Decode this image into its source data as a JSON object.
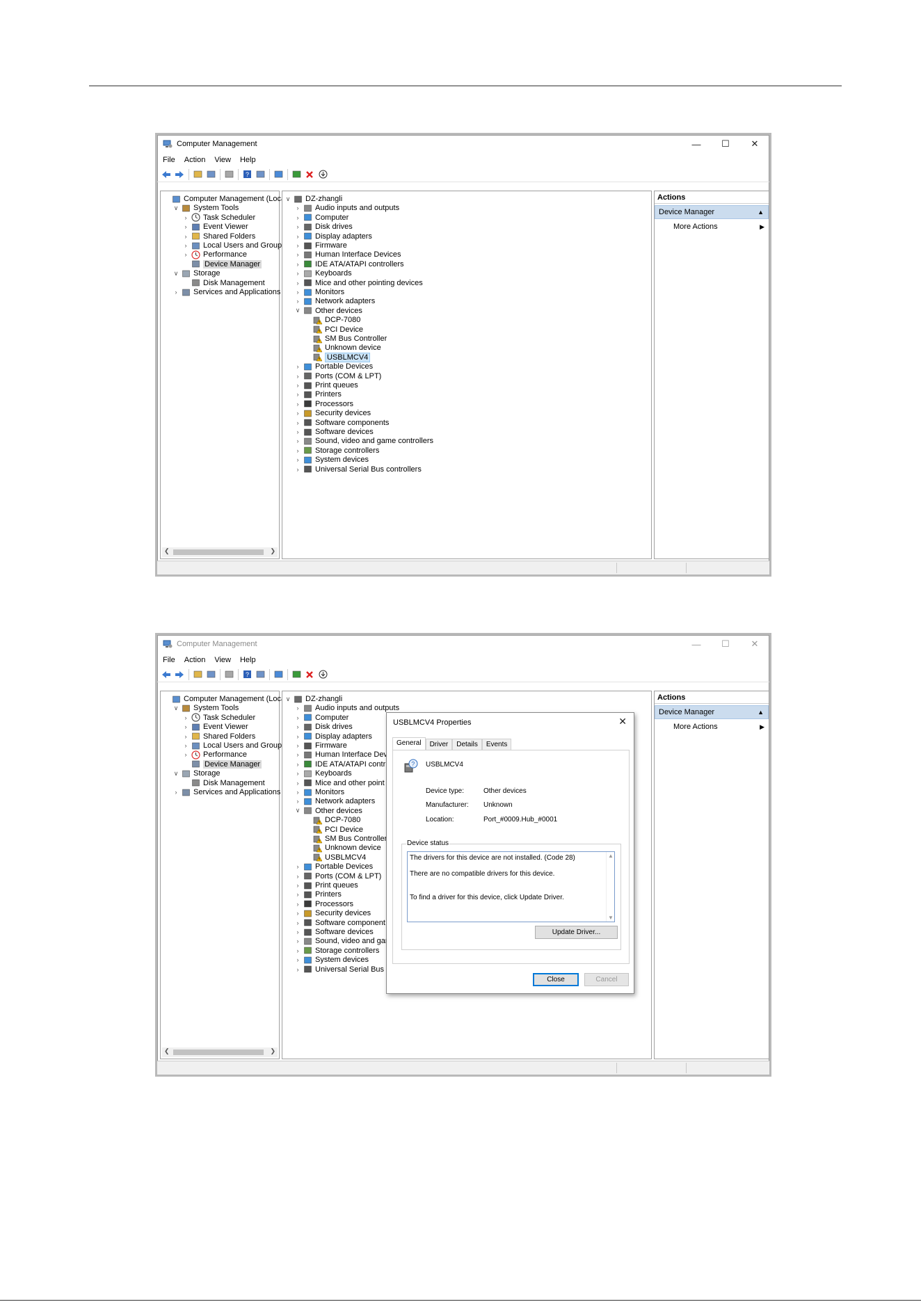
{
  "windows": [
    {
      "title": "Computer Management",
      "menu": [
        "File",
        "Action",
        "View",
        "Help"
      ],
      "left_tree": [
        {
          "label": "Computer Management (Local",
          "level": 0,
          "expander": "",
          "icon": "computer-management-icon",
          "selected": false
        },
        {
          "label": "System Tools",
          "level": 1,
          "expander": "down",
          "icon": "tools-icon",
          "selected": false
        },
        {
          "label": "Task Scheduler",
          "level": 2,
          "expander": "right",
          "icon": "clock-icon",
          "selected": false
        },
        {
          "label": "Event Viewer",
          "level": 2,
          "expander": "right",
          "icon": "event-viewer-icon",
          "selected": false
        },
        {
          "label": "Shared Folders",
          "level": 2,
          "expander": "right",
          "icon": "shared-folder-icon",
          "selected": false
        },
        {
          "label": "Local Users and Groups",
          "level": 2,
          "expander": "right",
          "icon": "users-icon",
          "selected": false
        },
        {
          "label": "Performance",
          "level": 2,
          "expander": "right",
          "icon": "performance-icon",
          "selected": false
        },
        {
          "label": "Device Manager",
          "level": 2,
          "expander": "",
          "icon": "device-manager-icon",
          "selected": true
        },
        {
          "label": "Storage",
          "level": 1,
          "expander": "down",
          "icon": "storage-icon",
          "selected": false
        },
        {
          "label": "Disk Management",
          "level": 2,
          "expander": "",
          "icon": "disk-icon",
          "selected": false
        },
        {
          "label": "Services and Applications",
          "level": 1,
          "expander": "right",
          "icon": "services-icon",
          "selected": false
        }
      ],
      "device_tree": [
        {
          "label": "DZ-zhangli",
          "level": 0,
          "expander": "down",
          "icon": "computer-icon",
          "selected": false
        },
        {
          "label": "Audio inputs and outputs",
          "level": 1,
          "expander": "right",
          "icon": "speaker-icon",
          "selected": false
        },
        {
          "label": "Computer",
          "level": 1,
          "expander": "right",
          "icon": "monitor-icon",
          "selected": false
        },
        {
          "label": "Disk drives",
          "level": 1,
          "expander": "right",
          "icon": "disk-drive-icon",
          "selected": false
        },
        {
          "label": "Display adapters",
          "level": 1,
          "expander": "right",
          "icon": "display-adapter-icon",
          "selected": false
        },
        {
          "label": "Firmware",
          "level": 1,
          "expander": "right",
          "icon": "firmware-icon",
          "selected": false
        },
        {
          "label": "Human Interface Devices",
          "level": 1,
          "expander": "right",
          "icon": "hid-icon",
          "selected": false
        },
        {
          "label": "IDE ATA/ATAPI controllers",
          "level": 1,
          "expander": "right",
          "icon": "ide-icon",
          "selected": false
        },
        {
          "label": "Keyboards",
          "level": 1,
          "expander": "right",
          "icon": "keyboard-icon",
          "selected": false
        },
        {
          "label": "Mice and other pointing devices",
          "level": 1,
          "expander": "right",
          "icon": "mouse-icon",
          "selected": false
        },
        {
          "label": "Monitors",
          "level": 1,
          "expander": "right",
          "icon": "monitor-icon",
          "selected": false
        },
        {
          "label": "Network adapters",
          "level": 1,
          "expander": "right",
          "icon": "network-icon",
          "selected": false
        },
        {
          "label": "Other devices",
          "level": 1,
          "expander": "down",
          "icon": "unknown-device-icon",
          "selected": false
        },
        {
          "label": "DCP-7080",
          "level": 2,
          "expander": "",
          "icon": "warning-device-icon",
          "selected": false
        },
        {
          "label": "PCI Device",
          "level": 2,
          "expander": "",
          "icon": "warning-device-icon",
          "selected": false
        },
        {
          "label": "SM Bus Controller",
          "level": 2,
          "expander": "",
          "icon": "warning-device-icon",
          "selected": false
        },
        {
          "label": "Unknown device",
          "level": 2,
          "expander": "",
          "icon": "warning-device-icon",
          "selected": false
        },
        {
          "label": "USBLMCV4",
          "level": 2,
          "expander": "",
          "icon": "warning-device-icon",
          "selected": true
        },
        {
          "label": "Portable Devices",
          "level": 1,
          "expander": "right",
          "icon": "portable-device-icon",
          "selected": false
        },
        {
          "label": "Ports (COM & LPT)",
          "level": 1,
          "expander": "right",
          "icon": "port-icon",
          "selected": false
        },
        {
          "label": "Print queues",
          "level": 1,
          "expander": "right",
          "icon": "printer-icon",
          "selected": false
        },
        {
          "label": "Printers",
          "level": 1,
          "expander": "right",
          "icon": "printer-icon",
          "selected": false
        },
        {
          "label": "Processors",
          "level": 1,
          "expander": "right",
          "icon": "processor-icon",
          "selected": false
        },
        {
          "label": "Security devices",
          "level": 1,
          "expander": "right",
          "icon": "security-icon",
          "selected": false
        },
        {
          "label": "Software components",
          "level": 1,
          "expander": "right",
          "icon": "software-component-icon",
          "selected": false
        },
        {
          "label": "Software devices",
          "level": 1,
          "expander": "right",
          "icon": "software-device-icon",
          "selected": false
        },
        {
          "label": "Sound, video and game controllers",
          "level": 1,
          "expander": "right",
          "icon": "speaker-icon",
          "selected": false
        },
        {
          "label": "Storage controllers",
          "level": 1,
          "expander": "right",
          "icon": "storage-controller-icon",
          "selected": false
        },
        {
          "label": "System devices",
          "level": 1,
          "expander": "right",
          "icon": "system-device-icon",
          "selected": false
        },
        {
          "label": "Universal Serial Bus controllers",
          "level": 1,
          "expander": "right",
          "icon": "usb-icon",
          "selected": false
        }
      ],
      "actions": {
        "header": "Actions",
        "selected": "Device Manager",
        "more": "More Actions"
      }
    },
    {
      "title": "Computer Management",
      "menu": [
        "File",
        "Action",
        "View",
        "Help"
      ],
      "left_tree": [
        {
          "label": "Computer Management (Local",
          "level": 0,
          "expander": "",
          "icon": "computer-management-icon",
          "selected": false
        },
        {
          "label": "System Tools",
          "level": 1,
          "expander": "down",
          "icon": "tools-icon",
          "selected": false
        },
        {
          "label": "Task Scheduler",
          "level": 2,
          "expander": "right",
          "icon": "clock-icon",
          "selected": false
        },
        {
          "label": "Event Viewer",
          "level": 2,
          "expander": "right",
          "icon": "event-viewer-icon",
          "selected": false
        },
        {
          "label": "Shared Folders",
          "level": 2,
          "expander": "right",
          "icon": "shared-folder-icon",
          "selected": false
        },
        {
          "label": "Local Users and Groups",
          "level": 2,
          "expander": "right",
          "icon": "users-icon",
          "selected": false
        },
        {
          "label": "Performance",
          "level": 2,
          "expander": "right",
          "icon": "performance-icon",
          "selected": false
        },
        {
          "label": "Device Manager",
          "level": 2,
          "expander": "",
          "icon": "device-manager-icon",
          "selected": true
        },
        {
          "label": "Storage",
          "level": 1,
          "expander": "down",
          "icon": "storage-icon",
          "selected": false
        },
        {
          "label": "Disk Management",
          "level": 2,
          "expander": "",
          "icon": "disk-icon",
          "selected": false
        },
        {
          "label": "Services and Applications",
          "level": 1,
          "expander": "right",
          "icon": "services-icon",
          "selected": false
        }
      ],
      "device_tree": [
        {
          "label": "DZ-zhangli",
          "level": 0,
          "expander": "down",
          "icon": "computer-icon",
          "selected": false
        },
        {
          "label": "Audio inputs and outputs",
          "level": 1,
          "expander": "right",
          "icon": "speaker-icon",
          "selected": false
        },
        {
          "label": "Computer",
          "level": 1,
          "expander": "right",
          "icon": "monitor-icon",
          "selected": false
        },
        {
          "label": "Disk drives",
          "level": 1,
          "expander": "right",
          "icon": "disk-drive-icon",
          "selected": false
        },
        {
          "label": "Display adapters",
          "level": 1,
          "expander": "right",
          "icon": "display-adapter-icon",
          "selected": false
        },
        {
          "label": "Firmware",
          "level": 1,
          "expander": "right",
          "icon": "firmware-icon",
          "selected": false
        },
        {
          "label": "Human Interface Dev",
          "level": 1,
          "expander": "right",
          "icon": "hid-icon",
          "selected": false
        },
        {
          "label": "IDE ATA/ATAPI contr",
          "level": 1,
          "expander": "right",
          "icon": "ide-icon",
          "selected": false
        },
        {
          "label": "Keyboards",
          "level": 1,
          "expander": "right",
          "icon": "keyboard-icon",
          "selected": false
        },
        {
          "label": "Mice and other point",
          "level": 1,
          "expander": "right",
          "icon": "mouse-icon",
          "selected": false
        },
        {
          "label": "Monitors",
          "level": 1,
          "expander": "right",
          "icon": "monitor-icon",
          "selected": false
        },
        {
          "label": "Network adapters",
          "level": 1,
          "expander": "right",
          "icon": "network-icon",
          "selected": false
        },
        {
          "label": "Other devices",
          "level": 1,
          "expander": "down",
          "icon": "unknown-device-icon",
          "selected": false
        },
        {
          "label": "DCP-7080",
          "level": 2,
          "expander": "",
          "icon": "warning-device-icon",
          "selected": false
        },
        {
          "label": "PCI Device",
          "level": 2,
          "expander": "",
          "icon": "warning-device-icon",
          "selected": false
        },
        {
          "label": "SM Bus Controller",
          "level": 2,
          "expander": "",
          "icon": "warning-device-icon",
          "selected": false
        },
        {
          "label": "Unknown device",
          "level": 2,
          "expander": "",
          "icon": "warning-device-icon",
          "selected": false
        },
        {
          "label": "USBLMCV4",
          "level": 2,
          "expander": "",
          "icon": "warning-device-icon",
          "selected": false
        },
        {
          "label": "Portable Devices",
          "level": 1,
          "expander": "right",
          "icon": "portable-device-icon",
          "selected": false
        },
        {
          "label": "Ports (COM & LPT)",
          "level": 1,
          "expander": "right",
          "icon": "port-icon",
          "selected": false
        },
        {
          "label": "Print queues",
          "level": 1,
          "expander": "right",
          "icon": "printer-icon",
          "selected": false
        },
        {
          "label": "Printers",
          "level": 1,
          "expander": "right",
          "icon": "printer-icon",
          "selected": false
        },
        {
          "label": "Processors",
          "level": 1,
          "expander": "right",
          "icon": "processor-icon",
          "selected": false
        },
        {
          "label": "Security devices",
          "level": 1,
          "expander": "right",
          "icon": "security-icon",
          "selected": false
        },
        {
          "label": "Software component",
          "level": 1,
          "expander": "right",
          "icon": "software-component-icon",
          "selected": false
        },
        {
          "label": "Software devices",
          "level": 1,
          "expander": "right",
          "icon": "software-device-icon",
          "selected": false
        },
        {
          "label": "Sound, video and gar",
          "level": 1,
          "expander": "right",
          "icon": "speaker-icon",
          "selected": false
        },
        {
          "label": "Storage controllers",
          "level": 1,
          "expander": "right",
          "icon": "storage-controller-icon",
          "selected": false
        },
        {
          "label": "System devices",
          "level": 1,
          "expander": "right",
          "icon": "system-device-icon",
          "selected": false
        },
        {
          "label": "Universal Serial Bus controllers",
          "level": 1,
          "expander": "right",
          "icon": "usb-icon",
          "selected": false
        }
      ],
      "actions": {
        "header": "Actions",
        "selected": "Device Manager",
        "more": "More Actions"
      }
    }
  ],
  "dialog": {
    "title": "USBLMCV4 Properties",
    "tabs": [
      "General",
      "Driver",
      "Details",
      "Events"
    ],
    "active_tab": "General",
    "device_name": "USBLMCV4",
    "properties": [
      {
        "label": "Device type:",
        "value": "Other devices"
      },
      {
        "label": "Manufacturer:",
        "value": "Unknown"
      },
      {
        "label": "Location:",
        "value": "Port_#0009.Hub_#0001"
      }
    ],
    "status_legend": "Device status",
    "status_lines": [
      "The drivers for this device are not installed. (Code 28)",
      "There are no compatible drivers for this device.",
      "To find a driver for this device, click Update Driver."
    ],
    "update_button": "Update Driver...",
    "close_button": "Close",
    "cancel_button": "Cancel"
  },
  "colors": {
    "selection": "#cce4f7",
    "actions_header": "#cbdcee",
    "warning": "#f2b600",
    "accent": "#0078d7"
  }
}
